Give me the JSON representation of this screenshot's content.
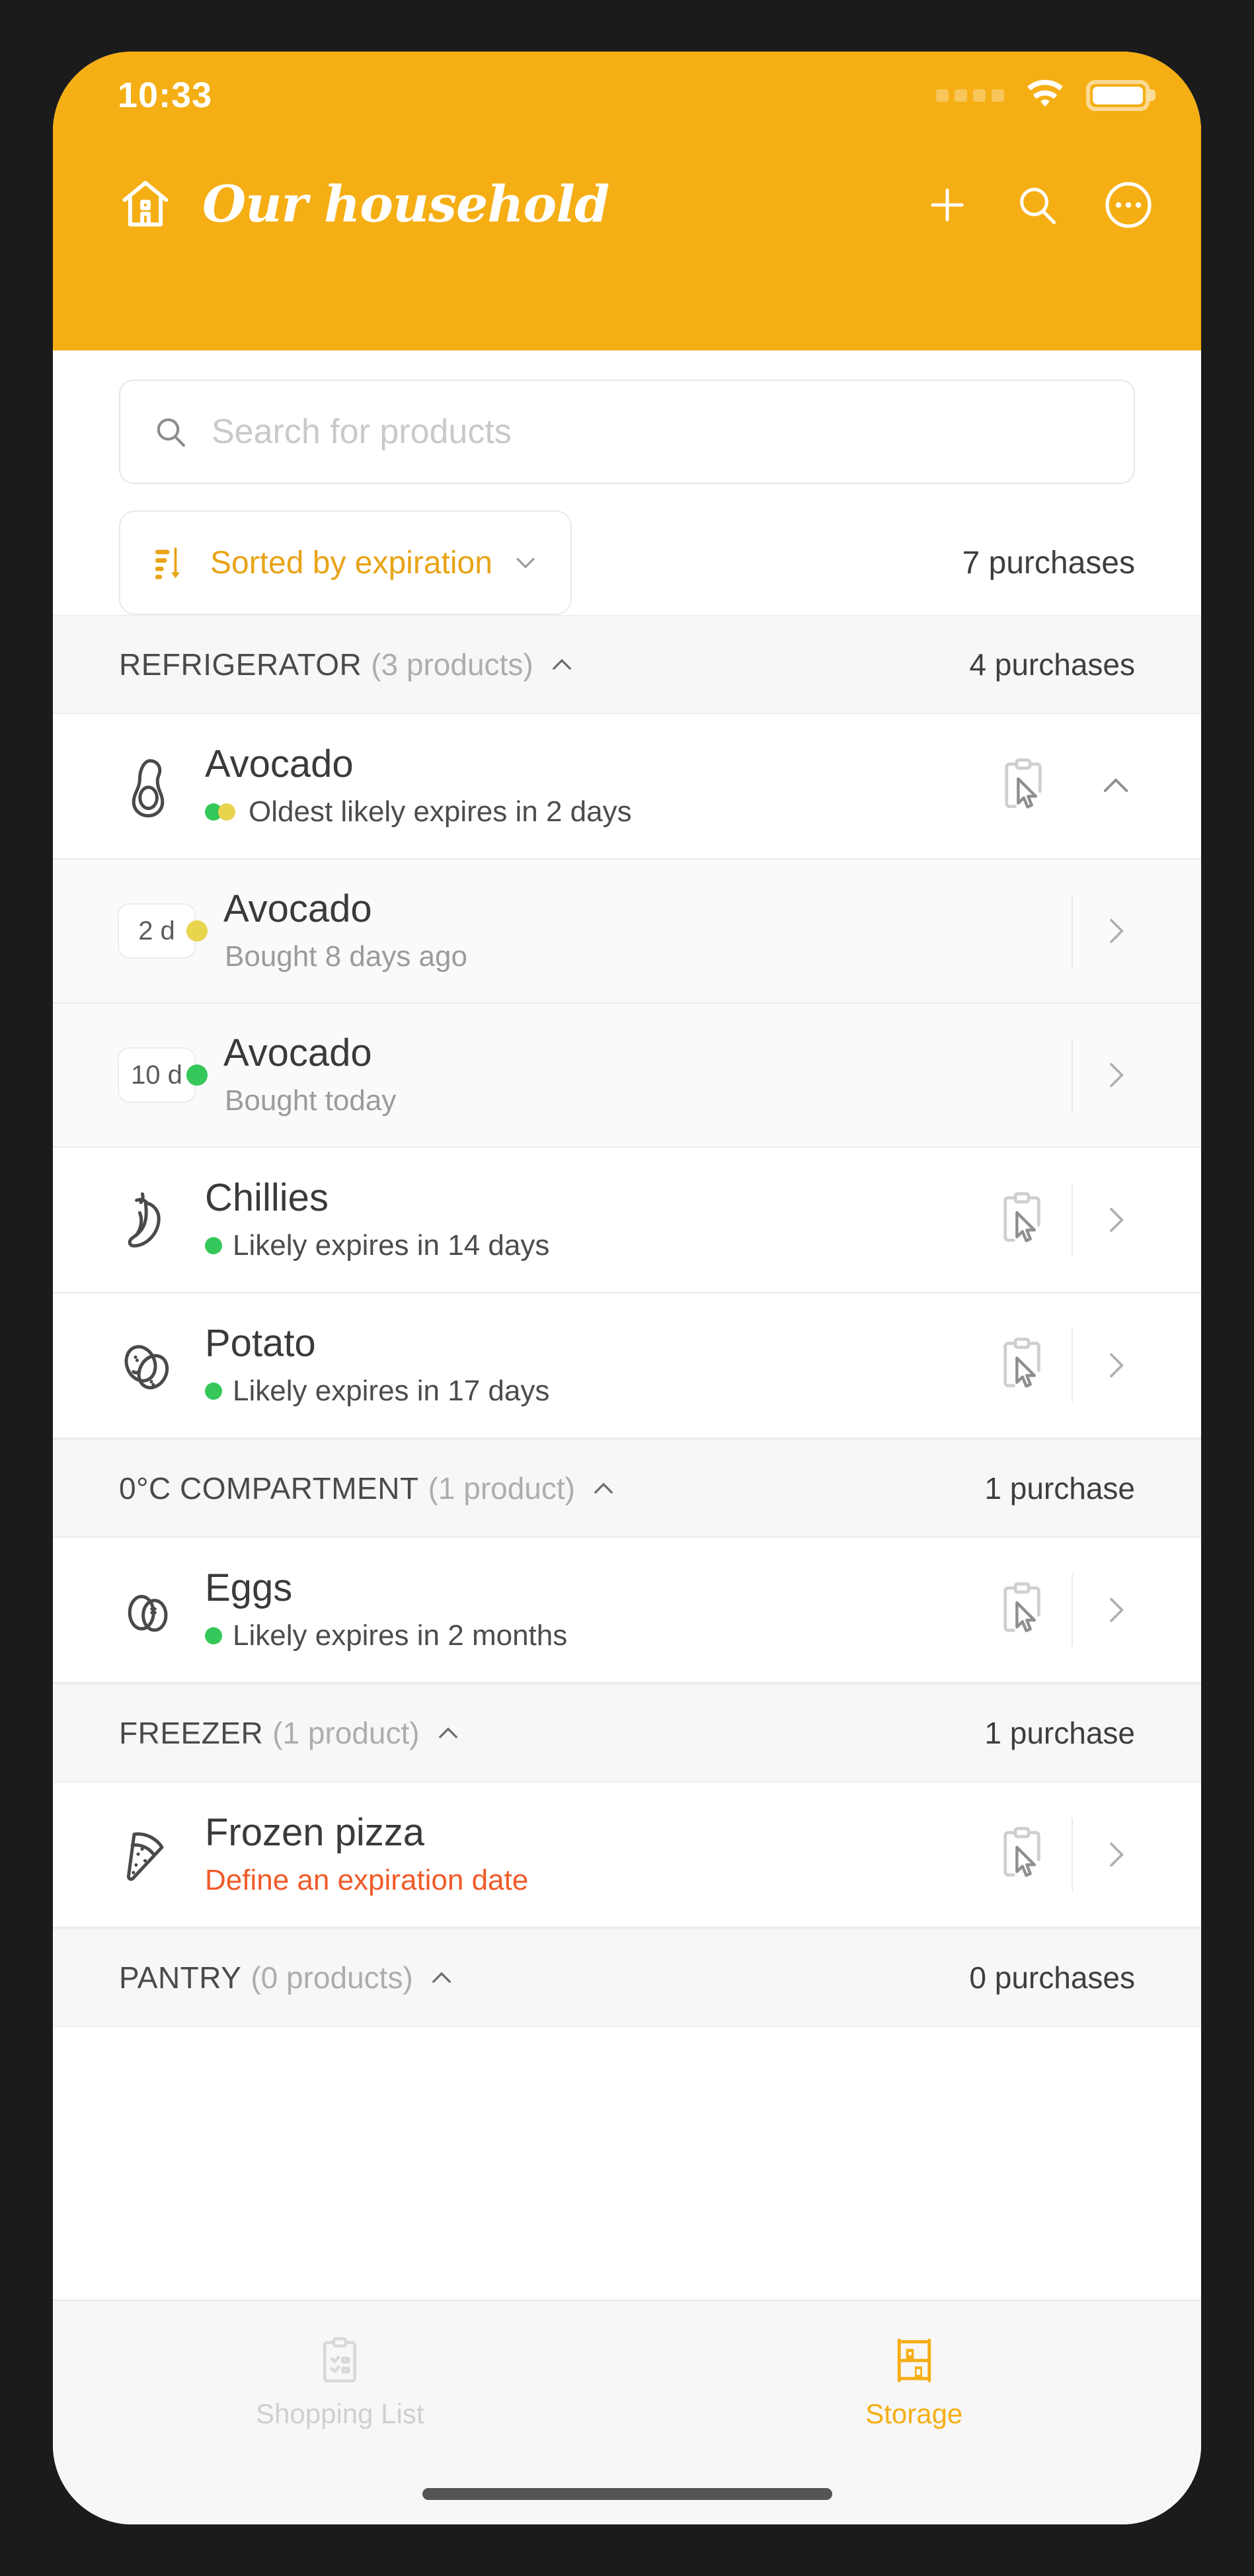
{
  "status_bar": {
    "time": "10:33",
    "signal_icon": "signal-dots-icon",
    "wifi_icon": "wifi-icon",
    "battery_icon": "battery-full-icon"
  },
  "app_bar": {
    "home_icon": "home-icon",
    "title": "Our household",
    "add_icon": "plus-icon",
    "search_icon": "search-icon",
    "more_icon": "more-circle-icon",
    "background_color": "#F5AE14"
  },
  "search": {
    "placeholder": "Search for products",
    "icon": "search-icon"
  },
  "sort": {
    "icon": "sort-descending-icon",
    "label": "Sorted by expiration",
    "chevron_icon": "chevron-down-icon",
    "total_purchases": "7 purchases",
    "accent_color": "#E8A317"
  },
  "sections": [
    {
      "name": "REFRIGERATOR",
      "count": "(3 products)",
      "chevron_icon": "chevron-up-icon",
      "purchases": "4 purchases",
      "products": [
        {
          "name": "Avocado",
          "icon": "avocado-icon",
          "status": "Oldest likely expires in 2 days",
          "status_dots": "pair",
          "status_color": "#4c4c4c",
          "clipboard_icon": "clipboard-cursor-icon",
          "trailing_icon": "chevron-up-icon",
          "expanded": true,
          "purchases": [
            {
              "days_badge": "2 d",
              "badge_dot": "yellow",
              "name": "Avocado",
              "note": "Bought 8 days ago",
              "trailing_icon": "chevron-right-icon"
            },
            {
              "days_badge": "10 d",
              "badge_dot": "green",
              "name": "Avocado",
              "note": "Bought today",
              "trailing_icon": "chevron-right-icon"
            }
          ]
        },
        {
          "name": "Chillies",
          "icon": "chili-icon",
          "status": "Likely expires in 14 days",
          "status_dots": "green",
          "status_color": "#4c4c4c",
          "clipboard_icon": "clipboard-cursor-icon",
          "trailing_icon": "chevron-right-icon",
          "expanded": false,
          "purchases": []
        },
        {
          "name": "Potato",
          "icon": "potato-icon",
          "status": "Likely expires in 17 days",
          "status_dots": "green",
          "status_color": "#4c4c4c",
          "clipboard_icon": "clipboard-cursor-icon",
          "trailing_icon": "chevron-right-icon",
          "expanded": false,
          "purchases": []
        }
      ]
    },
    {
      "name": "0°C COMPARTMENT",
      "count": "(1 product)",
      "chevron_icon": "chevron-up-icon",
      "purchases": "1 purchase",
      "products": [
        {
          "name": "Eggs",
          "icon": "eggs-icon",
          "status": "Likely expires in 2 months",
          "status_dots": "green",
          "status_color": "#4c4c4c",
          "clipboard_icon": "clipboard-cursor-icon",
          "trailing_icon": "chevron-right-icon",
          "expanded": false,
          "purchases": []
        }
      ]
    },
    {
      "name": "FREEZER",
      "count": "(1 product)",
      "chevron_icon": "chevron-up-icon",
      "purchases": "1 purchase",
      "products": [
        {
          "name": "Frozen pizza",
          "icon": "pizza-slice-icon",
          "status": "Define an expiration date",
          "status_dots": "none",
          "status_color": "#F05A28",
          "clipboard_icon": "clipboard-cursor-icon",
          "trailing_icon": "chevron-right-icon",
          "expanded": false,
          "purchases": []
        }
      ]
    },
    {
      "name": "PANTRY",
      "count": "(0 products)",
      "chevron_icon": "chevron-up-icon",
      "purchases": "0 purchases",
      "products": []
    }
  ],
  "bottom_nav": {
    "items": [
      {
        "label": "Shopping List",
        "icon": "clipboard-checklist-icon",
        "active": false
      },
      {
        "label": "Storage",
        "icon": "shelf-icon",
        "active": true
      }
    ],
    "active_color": "#F5AE14",
    "inactive_color": "#CFCFCF"
  }
}
